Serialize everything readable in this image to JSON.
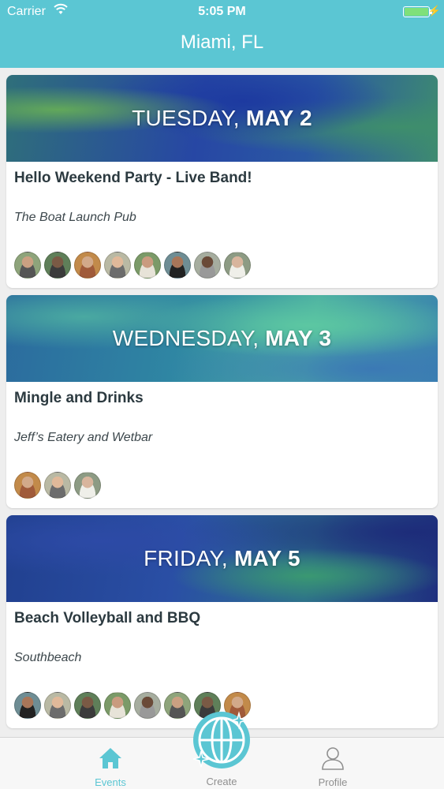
{
  "status_bar": {
    "carrier": "Carrier",
    "time": "5:05 PM",
    "battery_level": 1.0
  },
  "nav": {
    "title": "Miami, FL"
  },
  "colors": {
    "accent": "#5bc6d3",
    "tab_inactive": "#8f8f8f",
    "title_text": "#2c3a40"
  },
  "events": [
    {
      "day_of_week": "TUESDAY,",
      "date": "MAY 2",
      "title": "Hello Weekend Party - Live Band!",
      "venue": "The Boat Launch Pub",
      "attendee_count": 8
    },
    {
      "day_of_week": "WEDNESDAY,",
      "date": "MAY 3",
      "title": "Mingle and Drinks",
      "venue": "Jeff’s Eatery and Wetbar",
      "attendee_count": 3
    },
    {
      "day_of_week": "FRIDAY,",
      "date": "MAY 5",
      "title": "Beach Volleyball and BBQ",
      "venue": "Southbeach",
      "attendee_count": 8
    }
  ],
  "tabs": [
    {
      "label": "Events",
      "icon": "home-icon",
      "active": true
    },
    {
      "label": "Create",
      "icon": "globe-icon",
      "active": false
    },
    {
      "label": "Profile",
      "icon": "person-icon",
      "active": false
    }
  ]
}
